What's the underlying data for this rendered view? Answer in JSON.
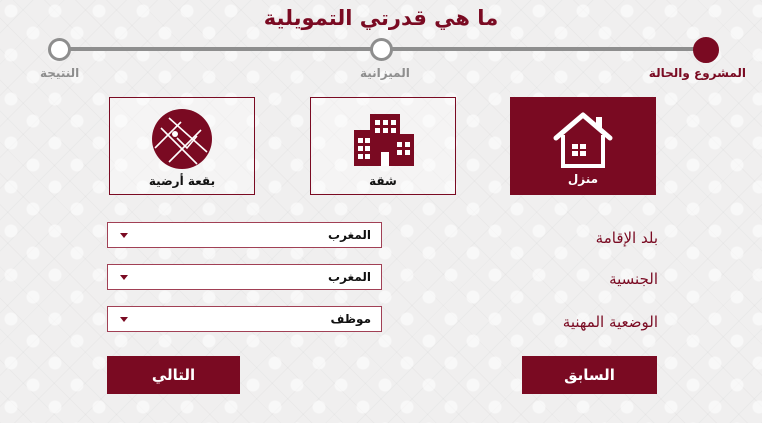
{
  "title": "ما هي قدرتي التمويلية",
  "colors": {
    "accent": "#7a0a22",
    "inactive": "#8e8e8e"
  },
  "steps": [
    {
      "label": "المشروع والحالة",
      "active": true
    },
    {
      "label": "الميزانية",
      "active": false
    },
    {
      "label": "النتيجة",
      "active": false
    }
  ],
  "property_types": [
    {
      "label": "منزل",
      "icon": "house-icon",
      "selected": true
    },
    {
      "label": "شقة",
      "icon": "apartment-building-icon",
      "selected": false
    },
    {
      "label": "بقعة أرضية",
      "icon": "land-plot-icon",
      "selected": false
    }
  ],
  "form": {
    "residence": {
      "label": "بلد الإقامة",
      "value": "المغرب"
    },
    "nationality": {
      "label": "الجنسية",
      "value": "المغرب"
    },
    "employment": {
      "label": "الوضعية المهنية",
      "value": "موظف"
    }
  },
  "buttons": {
    "previous": "السابق",
    "next": "التالي"
  }
}
